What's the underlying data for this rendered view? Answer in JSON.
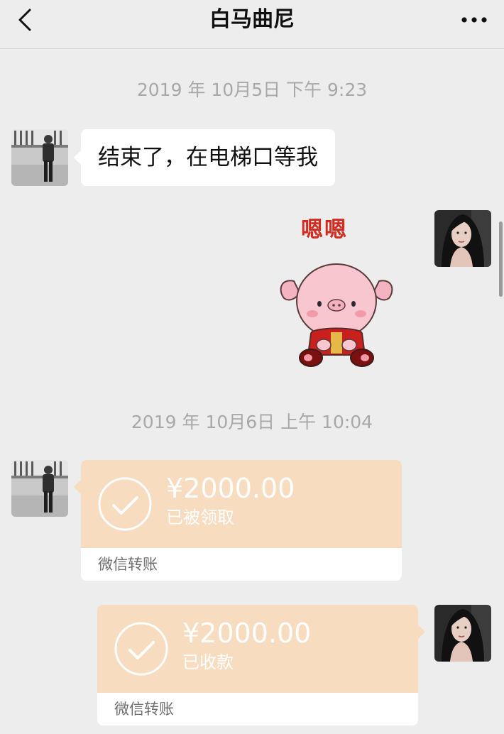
{
  "header": {
    "title": "白马曲尼",
    "back_icon": "chevron-left-icon",
    "more_icon": "more-dots-icon"
  },
  "messages": [
    {
      "type": "timestamp",
      "text": "2019 年 10月5日 下午 9:23"
    },
    {
      "type": "text",
      "sender": "contact",
      "text": "结束了，在电梯口等我"
    },
    {
      "type": "sticker",
      "sender": "me",
      "text": "嗯嗯",
      "icon": "pig-sticker-icon"
    },
    {
      "type": "timestamp",
      "text": "2019 年 10月6日 上午 10:04"
    },
    {
      "type": "transfer",
      "sender": "contact",
      "amount": "¥2000.00",
      "status": "已被领取",
      "label": "微信转账"
    },
    {
      "type": "transfer",
      "sender": "me",
      "amount": "¥2000.00",
      "status": "已收款",
      "label": "微信转账"
    }
  ],
  "colors": {
    "background": "#ededed",
    "transfer_orange": "#f8dcc0",
    "timestamp_gray": "#a8a8a8"
  }
}
